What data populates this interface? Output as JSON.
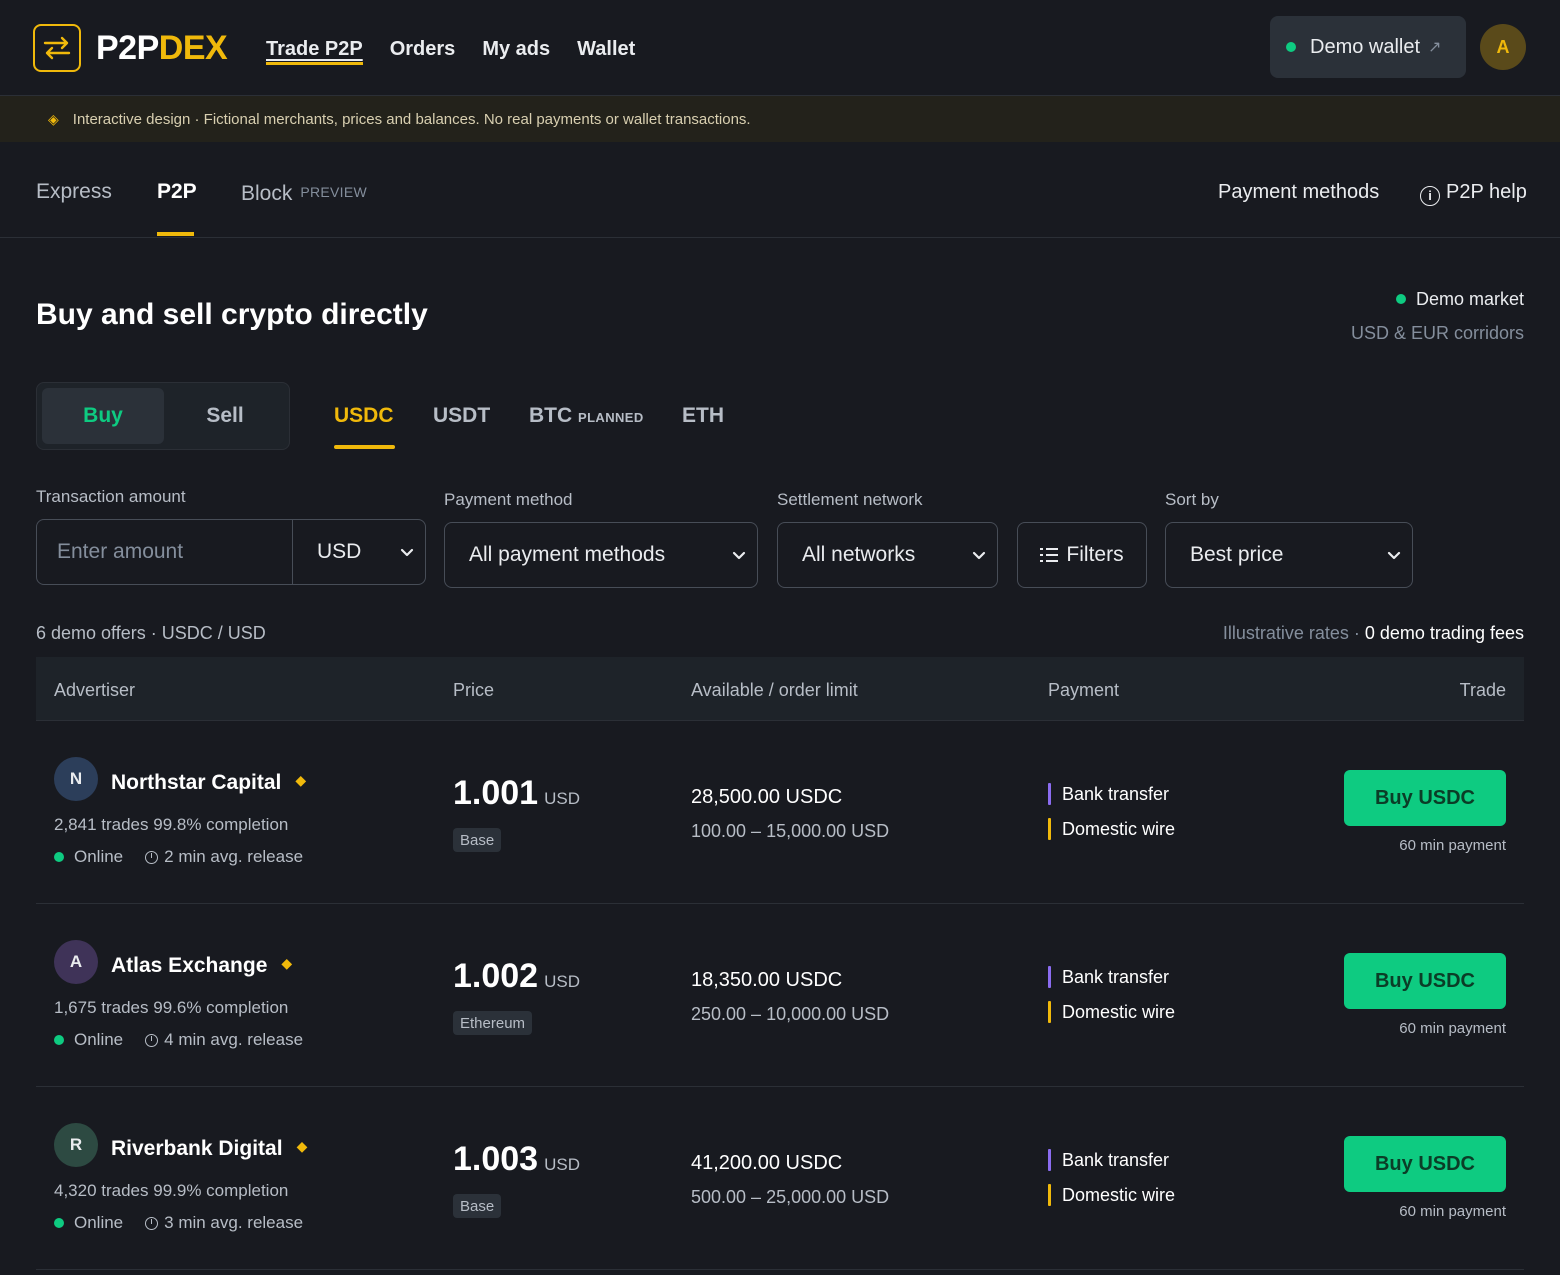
{
  "header": {
    "logo_a": "P2P",
    "logo_b": "DEX",
    "nav": [
      "Trade P2P",
      "Orders",
      "My ads",
      "Wallet"
    ],
    "demo_wallet": "Demo wallet",
    "avatar_initial": "A"
  },
  "notice": {
    "text": "Interactive design · Fictional merchants, prices and balances. No real payments or wallet transactions."
  },
  "subnav": {
    "tabs": [
      "Express",
      "P2P",
      "Block"
    ],
    "preview_tag": "PREVIEW",
    "payment_methods": "Payment methods",
    "help": "P2P help"
  },
  "page": {
    "title": "Buy and sell crypto directly",
    "market_status": "Demo market",
    "market_corridors": "USD & EUR corridors"
  },
  "toggle": {
    "buy": "Buy",
    "sell": "Sell"
  },
  "assets": {
    "tabs": [
      "USDC",
      "USDT",
      "BTC",
      "ETH"
    ],
    "planned_tag": "PLANNED"
  },
  "filters": {
    "amount_label": "Transaction amount",
    "amount_placeholder": "Enter amount",
    "currency": "USD",
    "payment_label": "Payment method",
    "payment_value": "All payment methods",
    "network_label": "Settlement network",
    "network_value": "All networks",
    "filters_button": "Filters",
    "sort_label": "Sort by",
    "sort_value": "Best price"
  },
  "summary": {
    "count": "6 demo offers · USDC / USD",
    "rates": "Illustrative rates · ",
    "fees": "0 demo trading fees"
  },
  "table": {
    "headers": [
      "Advertiser",
      "Price",
      "Available / order limit",
      "Payment",
      "Trade"
    ],
    "rows": [
      {
        "initial": "N",
        "name": "Northstar Capital",
        "stats": "2,841 trades 99.8% completion",
        "status": "Online",
        "release": "2 min avg. release",
        "price": "1.001",
        "price_unit": "USD",
        "network": "Base",
        "available": "28,500.00 USDC",
        "limit": "100.00 – 15,000.00 USD",
        "pay1": "Bank transfer",
        "pay2": "Domestic wire",
        "button": "Buy USDC",
        "pay_time": "60 min payment",
        "avatar_color": "#2c3e5a"
      },
      {
        "initial": "A",
        "name": "Atlas Exchange",
        "stats": "1,675 trades 99.6% completion",
        "status": "Online",
        "release": "4 min avg. release",
        "price": "1.002",
        "price_unit": "USD",
        "network": "Ethereum",
        "available": "18,350.00 USDC",
        "limit": "250.00 – 10,000.00 USD",
        "pay1": "Bank transfer",
        "pay2": "Domestic wire",
        "button": "Buy USDC",
        "pay_time": "60 min payment",
        "avatar_color": "#3f3358"
      },
      {
        "initial": "R",
        "name": "Riverbank Digital",
        "stats": "4,320 trades 99.9% completion",
        "status": "Online",
        "release": "3 min avg. release",
        "price": "1.003",
        "price_unit": "USD",
        "network": "Base",
        "available": "41,200.00 USDC",
        "limit": "500.00 – 25,000.00 USD",
        "pay1": "Bank transfer",
        "pay2": "Domestic wire",
        "button": "Buy USDC",
        "pay_time": "60 min payment",
        "avatar_color": "#2d4a42"
      }
    ]
  },
  "colors": {
    "accent": "#f0b90b",
    "buy_green": "#0ecb81",
    "background": "#181a20"
  }
}
